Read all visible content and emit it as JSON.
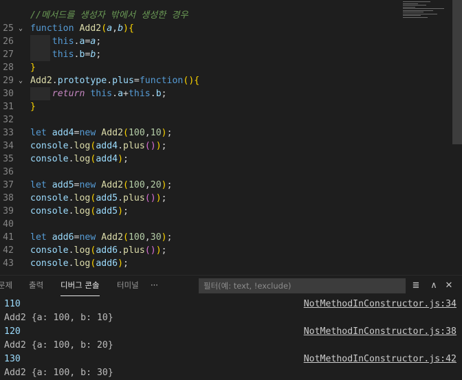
{
  "editor": {
    "lines": [
      {
        "num": "",
        "fold": "",
        "indent": false,
        "tokens": [
          {
            "t": "//메서드를 생성자 밖에서 생성한 경우",
            "c": "comment"
          }
        ]
      },
      {
        "num": "25",
        "fold": "⌄",
        "indent": false,
        "tokens": [
          {
            "t": "function ",
            "c": "kw"
          },
          {
            "t": "Add2",
            "c": "class"
          },
          {
            "t": "(",
            "c": "b1"
          },
          {
            "t": "a",
            "c": "param"
          },
          {
            "t": ",",
            "c": "punc"
          },
          {
            "t": "b",
            "c": "param"
          },
          {
            "t": ")",
            "c": "b1"
          },
          {
            "t": "{",
            "c": "b1"
          }
        ]
      },
      {
        "num": "26",
        "fold": "",
        "indent": true,
        "tokens": [
          {
            "t": "    this",
            "c": "kw"
          },
          {
            "t": ".",
            "c": "punc"
          },
          {
            "t": "a",
            "c": "var"
          },
          {
            "t": "=",
            "c": "punc"
          },
          {
            "t": "a",
            "c": "param"
          },
          {
            "t": ";",
            "c": "punc"
          }
        ]
      },
      {
        "num": "27",
        "fold": "",
        "indent": true,
        "tokens": [
          {
            "t": "    this",
            "c": "kw"
          },
          {
            "t": ".",
            "c": "punc"
          },
          {
            "t": "b",
            "c": "var"
          },
          {
            "t": "=",
            "c": "punc"
          },
          {
            "t": "b",
            "c": "param"
          },
          {
            "t": ";",
            "c": "punc"
          }
        ]
      },
      {
        "num": "28",
        "fold": "",
        "indent": false,
        "tokens": [
          {
            "t": "}",
            "c": "b1"
          }
        ]
      },
      {
        "num": "29",
        "fold": "⌄",
        "indent": false,
        "tokens": [
          {
            "t": "Add2",
            "c": "class"
          },
          {
            "t": ".",
            "c": "punc"
          },
          {
            "t": "prototype",
            "c": "var"
          },
          {
            "t": ".",
            "c": "punc"
          },
          {
            "t": "plus",
            "c": "var"
          },
          {
            "t": "=",
            "c": "punc"
          },
          {
            "t": "function",
            "c": "kw"
          },
          {
            "t": "()",
            "c": "b1"
          },
          {
            "t": "{",
            "c": "b1"
          }
        ]
      },
      {
        "num": "30",
        "fold": "",
        "indent": true,
        "tokens": [
          {
            "t": "    return",
            "c": "ctrl"
          },
          {
            "t": " this",
            "c": "kw"
          },
          {
            "t": ".",
            "c": "punc"
          },
          {
            "t": "a",
            "c": "var"
          },
          {
            "t": "+",
            "c": "punc"
          },
          {
            "t": "this",
            "c": "kw"
          },
          {
            "t": ".",
            "c": "punc"
          },
          {
            "t": "b",
            "c": "var"
          },
          {
            "t": ";",
            "c": "punc"
          }
        ]
      },
      {
        "num": "31",
        "fold": "",
        "indent": false,
        "tokens": [
          {
            "t": "}",
            "c": "b1"
          }
        ]
      },
      {
        "num": "32",
        "fold": "",
        "indent": false,
        "tokens": []
      },
      {
        "num": "33",
        "fold": "",
        "indent": false,
        "tokens": [
          {
            "t": "let ",
            "c": "kw"
          },
          {
            "t": "add4",
            "c": "var"
          },
          {
            "t": "=",
            "c": "punc"
          },
          {
            "t": "new ",
            "c": "kw"
          },
          {
            "t": "Add2",
            "c": "class"
          },
          {
            "t": "(",
            "c": "b1"
          },
          {
            "t": "100",
            "c": "num"
          },
          {
            "t": ",",
            "c": "punc"
          },
          {
            "t": "10",
            "c": "num"
          },
          {
            "t": ")",
            "c": "b1"
          },
          {
            "t": ";",
            "c": "punc"
          }
        ]
      },
      {
        "num": "34",
        "fold": "",
        "indent": false,
        "tokens": [
          {
            "t": "console",
            "c": "var"
          },
          {
            "t": ".",
            "c": "punc"
          },
          {
            "t": "log",
            "c": "fn"
          },
          {
            "t": "(",
            "c": "b1"
          },
          {
            "t": "add4",
            "c": "var"
          },
          {
            "t": ".",
            "c": "punc"
          },
          {
            "t": "plus",
            "c": "fn"
          },
          {
            "t": "()",
            "c": "b2"
          },
          {
            "t": ")",
            "c": "b1"
          },
          {
            "t": ";",
            "c": "punc"
          }
        ]
      },
      {
        "num": "35",
        "fold": "",
        "indent": false,
        "tokens": [
          {
            "t": "console",
            "c": "var"
          },
          {
            "t": ".",
            "c": "punc"
          },
          {
            "t": "log",
            "c": "fn"
          },
          {
            "t": "(",
            "c": "b1"
          },
          {
            "t": "add4",
            "c": "var"
          },
          {
            "t": ")",
            "c": "b1"
          },
          {
            "t": ";",
            "c": "punc"
          }
        ]
      },
      {
        "num": "36",
        "fold": "",
        "indent": false,
        "tokens": []
      },
      {
        "num": "37",
        "fold": "",
        "indent": false,
        "tokens": [
          {
            "t": "let ",
            "c": "kw"
          },
          {
            "t": "add5",
            "c": "var"
          },
          {
            "t": "=",
            "c": "punc"
          },
          {
            "t": "new ",
            "c": "kw"
          },
          {
            "t": "Add2",
            "c": "class"
          },
          {
            "t": "(",
            "c": "b1"
          },
          {
            "t": "100",
            "c": "num"
          },
          {
            "t": ",",
            "c": "punc"
          },
          {
            "t": "20",
            "c": "num"
          },
          {
            "t": ")",
            "c": "b1"
          },
          {
            "t": ";",
            "c": "punc"
          }
        ]
      },
      {
        "num": "38",
        "fold": "",
        "indent": false,
        "tokens": [
          {
            "t": "console",
            "c": "var"
          },
          {
            "t": ".",
            "c": "punc"
          },
          {
            "t": "log",
            "c": "fn"
          },
          {
            "t": "(",
            "c": "b1"
          },
          {
            "t": "add5",
            "c": "var"
          },
          {
            "t": ".",
            "c": "punc"
          },
          {
            "t": "plus",
            "c": "fn"
          },
          {
            "t": "()",
            "c": "b2"
          },
          {
            "t": ")",
            "c": "b1"
          },
          {
            "t": ";",
            "c": "punc"
          }
        ]
      },
      {
        "num": "39",
        "fold": "",
        "indent": false,
        "tokens": [
          {
            "t": "console",
            "c": "var"
          },
          {
            "t": ".",
            "c": "punc"
          },
          {
            "t": "log",
            "c": "fn"
          },
          {
            "t": "(",
            "c": "b1"
          },
          {
            "t": "add5",
            "c": "var"
          },
          {
            "t": ")",
            "c": "b1"
          },
          {
            "t": ";",
            "c": "punc"
          }
        ]
      },
      {
        "num": "40",
        "fold": "",
        "indent": false,
        "tokens": []
      },
      {
        "num": "41",
        "fold": "",
        "indent": false,
        "tokens": [
          {
            "t": "let ",
            "c": "kw"
          },
          {
            "t": "add6",
            "c": "var"
          },
          {
            "t": "=",
            "c": "punc"
          },
          {
            "t": "new ",
            "c": "kw"
          },
          {
            "t": "Add2",
            "c": "class"
          },
          {
            "t": "(",
            "c": "b1"
          },
          {
            "t": "100",
            "c": "num"
          },
          {
            "t": ",",
            "c": "punc"
          },
          {
            "t": "30",
            "c": "num"
          },
          {
            "t": ")",
            "c": "b1"
          },
          {
            "t": ";",
            "c": "punc"
          }
        ]
      },
      {
        "num": "42",
        "fold": "",
        "indent": false,
        "tokens": [
          {
            "t": "console",
            "c": "var"
          },
          {
            "t": ".",
            "c": "punc"
          },
          {
            "t": "log",
            "c": "fn"
          },
          {
            "t": "(",
            "c": "b1"
          },
          {
            "t": "add6",
            "c": "var"
          },
          {
            "t": ".",
            "c": "punc"
          },
          {
            "t": "plus",
            "c": "fn"
          },
          {
            "t": "()",
            "c": "b2"
          },
          {
            "t": ")",
            "c": "b1"
          },
          {
            "t": ";",
            "c": "punc"
          }
        ]
      },
      {
        "num": "43",
        "fold": "",
        "indent": false,
        "tokens": [
          {
            "t": "console",
            "c": "var"
          },
          {
            "t": ".",
            "c": "punc"
          },
          {
            "t": "log",
            "c": "fn"
          },
          {
            "t": "(",
            "c": "b1"
          },
          {
            "t": "add6",
            "c": "var"
          },
          {
            "t": ")",
            "c": "b1"
          },
          {
            "t": ";",
            "c": "punc"
          }
        ]
      }
    ]
  },
  "panel": {
    "tabs": [
      {
        "label": "문제",
        "active": false
      },
      {
        "label": "출력",
        "active": false
      },
      {
        "label": "디버그 콘솔",
        "active": true
      },
      {
        "label": "터미널",
        "active": false
      }
    ],
    "more_label": "···",
    "filter_placeholder": "필터(예: text, !exclude)",
    "icons": [
      "clear-filter-icon",
      "maximize-panel-icon",
      "close-panel-icon"
    ],
    "icon_glyphs": [
      "≣",
      "∧",
      "✕"
    ]
  },
  "console": {
    "rows": [
      {
        "value": "110",
        "kind": "num",
        "source": "NotMethodInConstructor.js:34"
      },
      {
        "value": "Add2 {a: 100, b: 10}",
        "kind": "obj",
        "source": ""
      },
      {
        "value": "120",
        "kind": "num",
        "source": "NotMethodInConstructor.js:38"
      },
      {
        "value": "Add2 {a: 100, b: 20}",
        "kind": "obj",
        "source": ""
      },
      {
        "value": "130",
        "kind": "num",
        "source": "NotMethodInConstructor.js:42"
      },
      {
        "value": "Add2 {a: 100, b: 30}",
        "kind": "obj",
        "source": ""
      }
    ]
  }
}
